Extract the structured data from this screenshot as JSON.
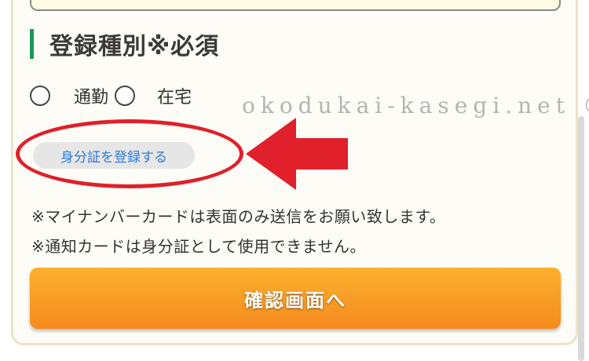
{
  "section": {
    "title": "登録種別※必須"
  },
  "radio_options": [
    {
      "label": "通勤",
      "selected": false
    },
    {
      "label": "在宅",
      "selected": false
    }
  ],
  "id_button": {
    "label": "身分証を登録する"
  },
  "notes": [
    "※マイナンバーカードは表面のみ送信をお願い致します。",
    "※通知カードは身分証として使用できません。"
  ],
  "confirm_button": {
    "label": "確認画面へ"
  },
  "watermark": "okodukai-kasegi.net ©",
  "colors": {
    "heading_accent": "#1a9a5a",
    "link_text": "#2f7bd6",
    "button_orange": "#f7941d",
    "annotation_red": "#e0202a"
  }
}
